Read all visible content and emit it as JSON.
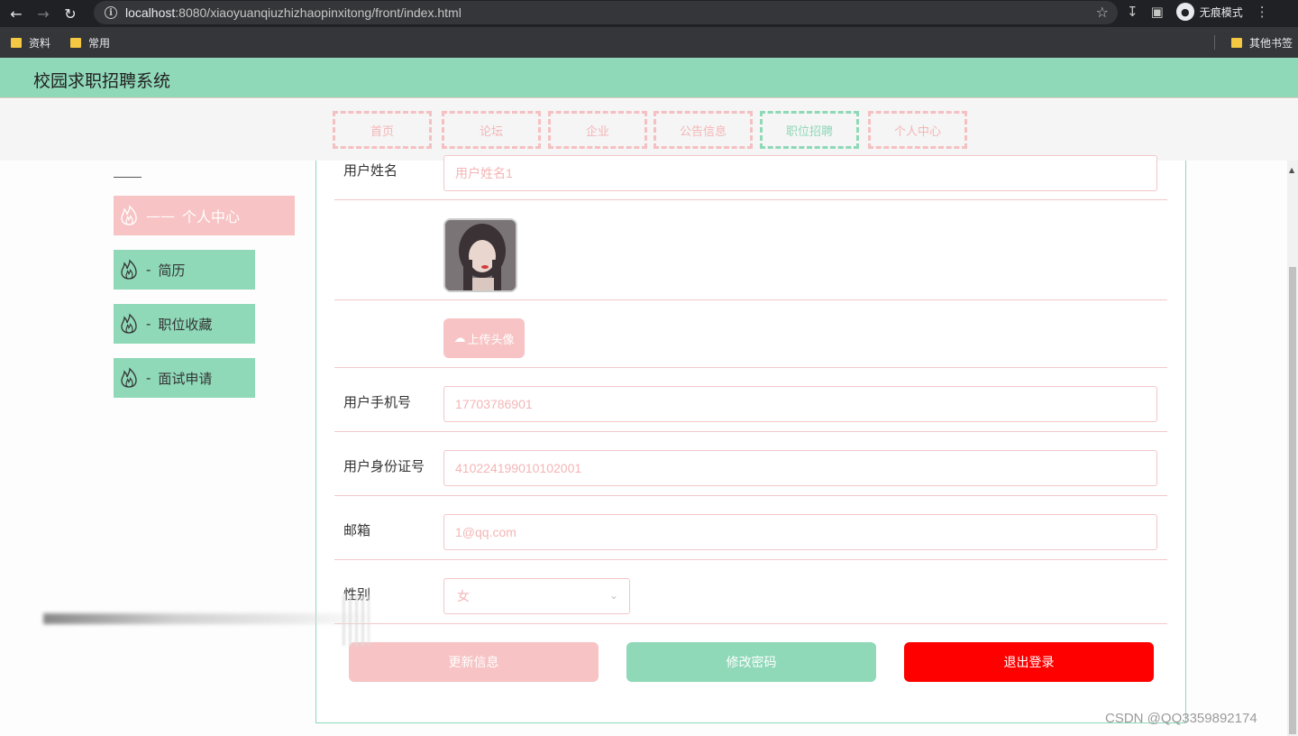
{
  "browser": {
    "url_host": "localhost",
    "url_rest": ":8080/xiaoyuanqiuzhizhaopinxitong/front/index.html",
    "incognito_label": "无痕模式",
    "bookmarks": [
      "资料",
      "常用"
    ],
    "other_bookmarks": "其他书签"
  },
  "app": {
    "title": "校园求职招聘系统",
    "accent_color": "#8fd8b8",
    "pink_color": "#f7c3c4"
  },
  "topnav": {
    "items": [
      "首页",
      "论坛",
      "企业",
      "公告信息",
      "职位招聘",
      "个人中心"
    ],
    "active": "职位招聘"
  },
  "sidebar": {
    "active": {
      "prefix": "——",
      "label": "个人中心"
    },
    "items": [
      {
        "prefix": "-",
        "label": "简历"
      },
      {
        "prefix": "-",
        "label": "职位收藏"
      },
      {
        "prefix": "-",
        "label": "面试申请"
      }
    ]
  },
  "form": {
    "username_label": "用户姓名",
    "username_value": "用户姓名1",
    "upload_label": "上传头像",
    "phone_label": "用户手机号",
    "phone_value": "17703786901",
    "idcard_label": "用户身份证号",
    "idcard_value": "410224199010102001",
    "email_label": "邮箱",
    "email_value": "1@qq.com",
    "gender_label": "性别",
    "gender_value": "女"
  },
  "actions": {
    "update": "更新信息",
    "change_password": "修改密码",
    "logout": "退出登录"
  },
  "watermark": "CSDN @QQ3359892174"
}
